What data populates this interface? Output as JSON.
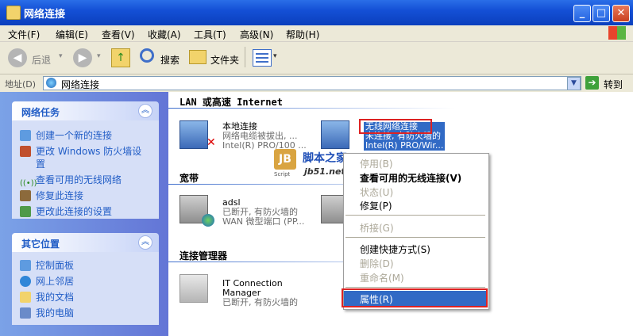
{
  "window": {
    "title": "网络连接",
    "min": "_",
    "max": "□",
    "close": "✕"
  },
  "menubar": {
    "items": [
      "文件(F)",
      "编辑(E)",
      "查看(V)",
      "收藏(A)",
      "工具(T)",
      "高级(N)",
      "帮助(H)"
    ]
  },
  "toolbar": {
    "back": "后退",
    "search": "搜索",
    "folders": "文件夹"
  },
  "address": {
    "label": "地址(D)",
    "value": "网络连接",
    "go": "转到"
  },
  "left": {
    "tasks_title": "网络任务",
    "tasks": [
      "创建一个新的连接",
      "更改 Windows 防火墙设",
      "置",
      "查看可用的无线网络",
      "修复此连接",
      "更改此连接的设置"
    ],
    "places_title": "其它位置",
    "places": [
      "控制面板",
      "网上邻居",
      "我的文档",
      "我的电脑"
    ]
  },
  "groups": {
    "lan": "LAN 或高速 Internet",
    "broadband": "宽带",
    "manager": "连接管理器"
  },
  "items": {
    "local": {
      "name": "本地连接",
      "status": "网络电缆被拔出, ...",
      "device": "Intel(R) PRO/100 ..."
    },
    "wireless": {
      "name": "无线网络连接",
      "status": "未连接, 有防火墙的",
      "device": "Intel(R) PRO/Wir..."
    },
    "adsl": {
      "name": "adsl",
      "status": "已断开, 有防火墙的",
      "device": "WAN 微型端口 (PP..."
    },
    "itcm": {
      "name": "IT Connection",
      "name2": "Manager",
      "status": "已断开, 有防火墙的"
    }
  },
  "context_menu": {
    "disable": "停用(B)",
    "view_wireless": "查看可用的无线连接(V)",
    "status": "状态(U)",
    "repair": "修复(P)",
    "bridge": "桥接(G)",
    "shortcut": "创建快捷方式(S)",
    "delete": "删除(D)",
    "rename": "重命名(M)",
    "properties": "属性(R)"
  },
  "watermark": {
    "title": "脚本之家",
    "url": "jb51.net",
    "tag": "Script"
  }
}
